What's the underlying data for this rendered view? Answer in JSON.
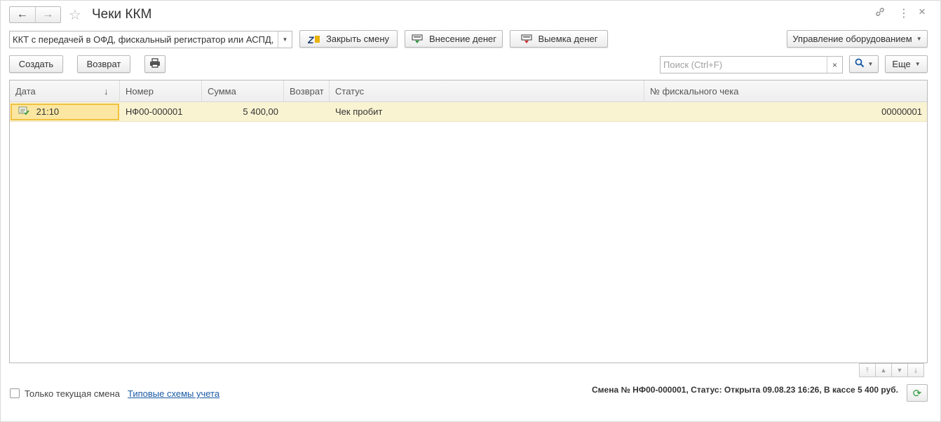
{
  "window": {
    "title": "Чеки ККМ",
    "back_icon": "←",
    "forward_icon": "→",
    "favorite_icon": "☆",
    "link_icon": "🔗",
    "more_icon": "⋮",
    "close_icon": "×"
  },
  "toolbar1": {
    "device_select_value": "ККТ с передачей в ОФД, фискальный регистратор или АСПД,",
    "close_shift": "Закрыть смену",
    "cash_in": "Внесение денег",
    "cash_out": "Выемка денег",
    "equipment": "Управление оборудованием"
  },
  "toolbar2": {
    "create": "Создать",
    "return": "Возврат",
    "search_placeholder": "Поиск (Ctrl+F)",
    "more": "Еще",
    "search_icon": "🔍"
  },
  "table": {
    "columns": [
      "Дата",
      "Номер",
      "Сумма",
      "Возврат",
      "Статус",
      "№ фискального чека"
    ],
    "sort_indicator": "↓",
    "rows": [
      {
        "date": "21:10",
        "number": "НФ00-000001",
        "sum": "5 400,00",
        "return": "",
        "status": "Чек пробит",
        "fiscal_no": "00000001"
      }
    ]
  },
  "footer": {
    "only_current_shift": "Только текущая смена",
    "schemes_link": "Типовые схемы учета",
    "status_text": "Смена № НФ00-000001, Статус: Открыта 09.08.23 16:26, В кассе 5 400 руб.",
    "refresh_icon": "⟳"
  },
  "colors": {
    "accent_link": "#1a5aa6",
    "row_highlight": "#faf3d2",
    "selected_cell": "#fbe7a1",
    "refresh_green": "#2c9a3a"
  }
}
